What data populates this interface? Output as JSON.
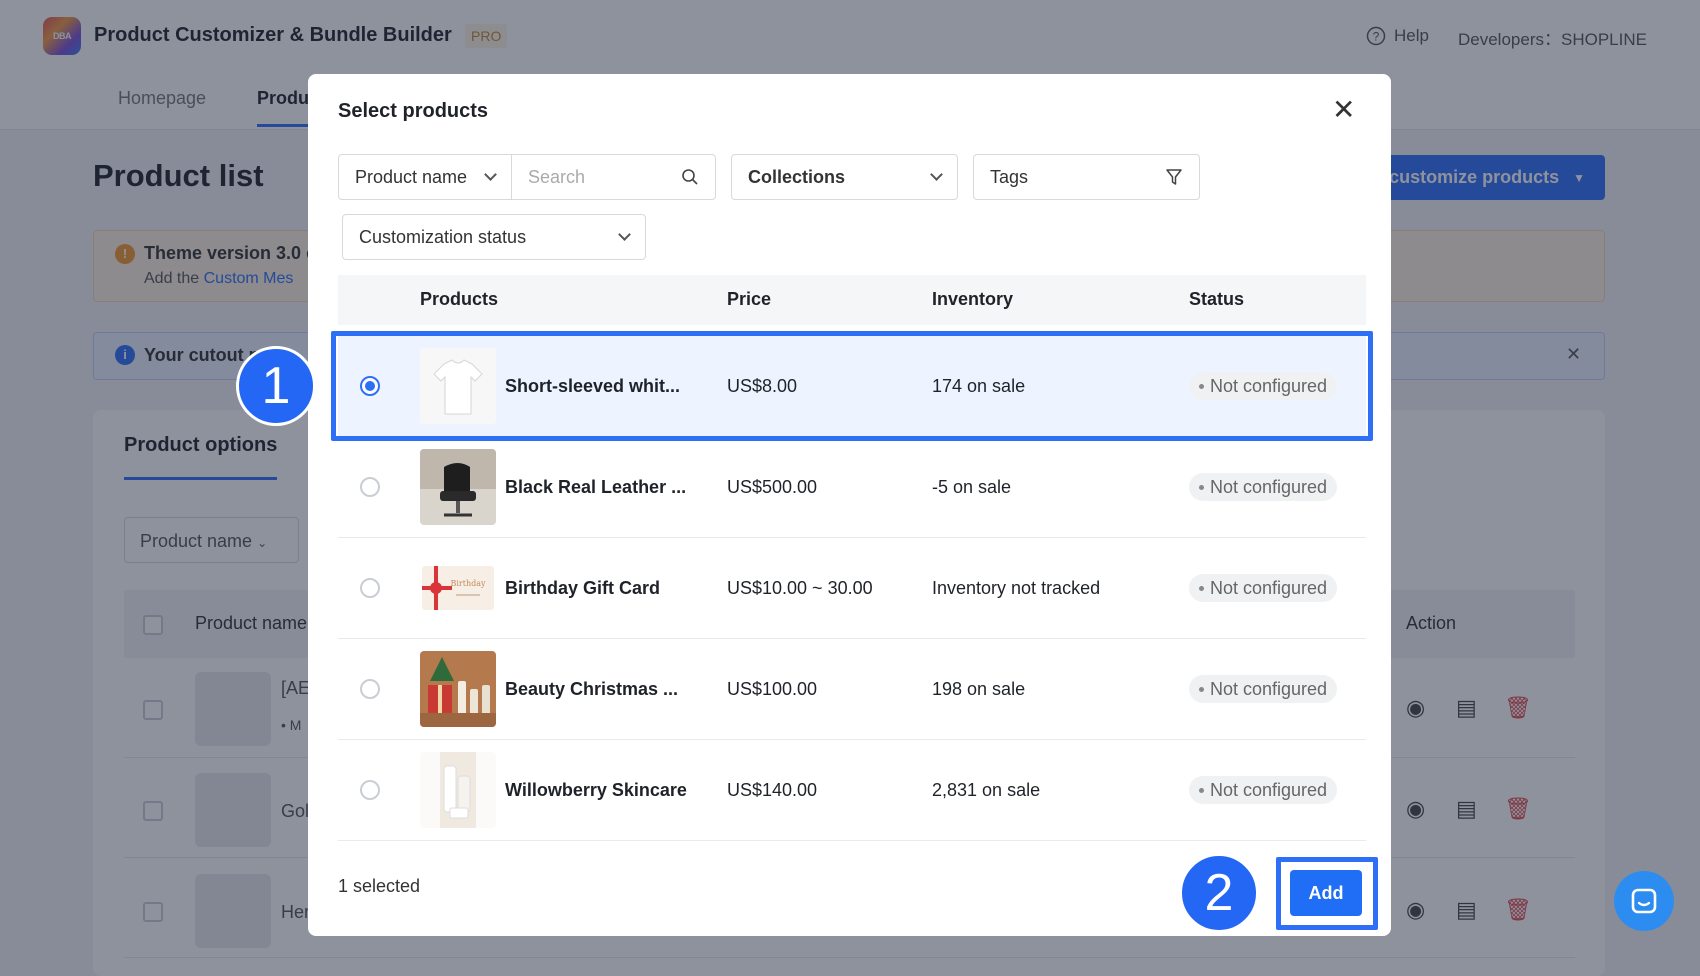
{
  "app": {
    "logo_text": "DBA",
    "title": "Product Customizer & Bundle Builder",
    "badge": "PRO",
    "help": "Help",
    "developers": "Developers：SHOPLINE"
  },
  "nav": {
    "tabs": [
      "Homepage",
      "Produ"
    ]
  },
  "page": {
    "title": "Product list",
    "customize_button": "customize products",
    "warning_title": "Theme version 3.0 c",
    "warning_sub_prefix": "Add the ",
    "warning_sub_link": "Custom Mes",
    "info_text": "Your cutout p",
    "card_tab": "Product options",
    "filter_select": "Product name",
    "table_header_name": "Product name",
    "table_header_action": "Action",
    "rows": [
      {
        "name": "[AE",
        "sub": "• M"
      },
      {
        "name": "Gol"
      },
      {
        "name": "Her"
      }
    ]
  },
  "modal": {
    "title": "Select products",
    "filters": {
      "field_select": "Product name",
      "search_placeholder": "Search",
      "collections": "Collections",
      "tags": "Tags",
      "customization_status": "Customization status"
    },
    "columns": [
      "Products",
      "Price",
      "Inventory",
      "Status"
    ],
    "products": [
      {
        "name": "Short-sleeved whit...",
        "price": "US$8.00",
        "inventory": "174 on sale",
        "status": "Not configured",
        "selected": true,
        "thumb": "tshirt"
      },
      {
        "name": "Black Real Leather ...",
        "price": "US$500.00",
        "inventory": "-5 on sale",
        "status": "Not configured",
        "selected": false,
        "thumb": "chair"
      },
      {
        "name": "Birthday Gift Card",
        "price": "US$10.00 ~ 30.00",
        "inventory": "Inventory not tracked",
        "status": "Not configured",
        "selected": false,
        "thumb": "giftcard"
      },
      {
        "name": "Beauty Christmas ...",
        "price": "US$100.00",
        "inventory": "198 on sale",
        "status": "Not configured",
        "selected": false,
        "thumb": "christmas"
      },
      {
        "name": "Willowberry Skincare",
        "price": "US$140.00",
        "inventory": "2,831 on sale",
        "status": "Not configured",
        "selected": false,
        "thumb": "skincare"
      }
    ],
    "selected_count": "1 selected",
    "add_button": "Add"
  },
  "annotations": {
    "step1": "1",
    "step2": "2"
  },
  "colors": {
    "accent": "#2d6ff7",
    "highlight": "#2567f5",
    "chat": "#2d8cf0"
  }
}
